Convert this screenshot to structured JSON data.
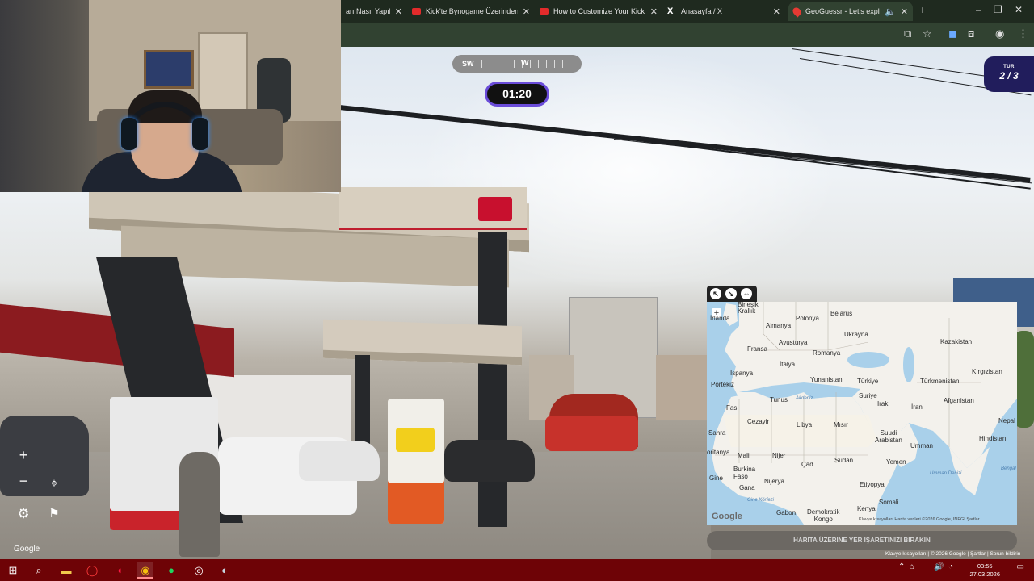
{
  "browser": {
    "tabs": [
      {
        "label": "arı Nasıl Yapılır",
        "icon": "generic-icon"
      },
      {
        "label": "Kick'te Bynogame Üzerinden Nasıl",
        "icon": "youtube-icon"
      },
      {
        "label": "How to Customize Your Kick Cha",
        "icon": "youtube-icon"
      },
      {
        "label": "Anasayfa / X",
        "icon": "x-icon"
      },
      {
        "label": "GeoGuessr - Let's explore th",
        "icon": "geoguessr-icon",
        "active": true
      }
    ],
    "new_tab": "+",
    "close_glyph": "✕"
  },
  "game": {
    "compass_left": "SW",
    "compass_center": "W",
    "timer": "01:20",
    "round_label": "TUR",
    "round_value": "2 / 3",
    "place_button": "HARİTA ÜZERİNE YER İŞARETİNİZİ BIRAKIN",
    "street_watermark": "Google"
  },
  "map": {
    "watermark": "Google",
    "attribution": "Klavye kısayolları   Harita verileri ©2026 Google, INEGI   Şartlar",
    "labels": {
      "birlesik_krallik": "Birleşik\nKrallık",
      "irlanda": "İrlanda",
      "almanya": "Almanya",
      "polonya": "Polonya",
      "belarus": "Belarus",
      "ukrayna": "Ukrayna",
      "fransa": "Fransa",
      "avusturya": "Avusturya",
      "romanya": "Romanya",
      "kazakistan": "Kazakistan",
      "ispanya": "İspanya",
      "italya": "İtalya",
      "yunanistan": "Yunanistan",
      "turkiye": "Türkiye",
      "turkmenistan": "Türkmenistan",
      "kirgizistan": "Kırgızistan",
      "portekiz": "Portekiz",
      "suriye": "Suriye",
      "tunus": "Tunus",
      "akdeniz": "Akdeniz",
      "irak": "Irak",
      "iran": "İran",
      "afganistan": "Afganistan",
      "fas": "Fas",
      "cezayir": "Cezayir",
      "libya": "Libya",
      "misir": "Mısır",
      "suudi": "Suudi\nArabistan",
      "nepal": "Nepal",
      "sahra": "Sahra",
      "hindistan": "Hindistan",
      "umman": "Umman",
      "moritanya": "oritanya",
      "mali": "Mali",
      "nijer": "Nijer",
      "cad": "Çad",
      "sudan": "Sudan",
      "yemen": "Yemen",
      "burkina": "Burkina\nFaso",
      "gine": "Gine",
      "gana": "Gana",
      "nijerya": "Nijerya",
      "etiyopya": "Etiyopya",
      "umman_denizi": "Umman Denizi",
      "bengal": "Bengal",
      "somali": "Somali",
      "gine_korfezi": "Gine Körfezi",
      "gabon": "Gabon",
      "dk": "Demokratik\nKongo",
      "kenya": "Kenya"
    }
  },
  "footer": "Klavye kısayolları | © 2026 Google | Şartlar | Sorun bildirin",
  "taskbar": {
    "time": "03:55",
    "date": "27.03.2026"
  },
  "colors": {
    "taskbar": "#6e0306",
    "timer_border": "#6a4cd9",
    "round_badge": "#211d5c",
    "browser_active": "#314231"
  }
}
